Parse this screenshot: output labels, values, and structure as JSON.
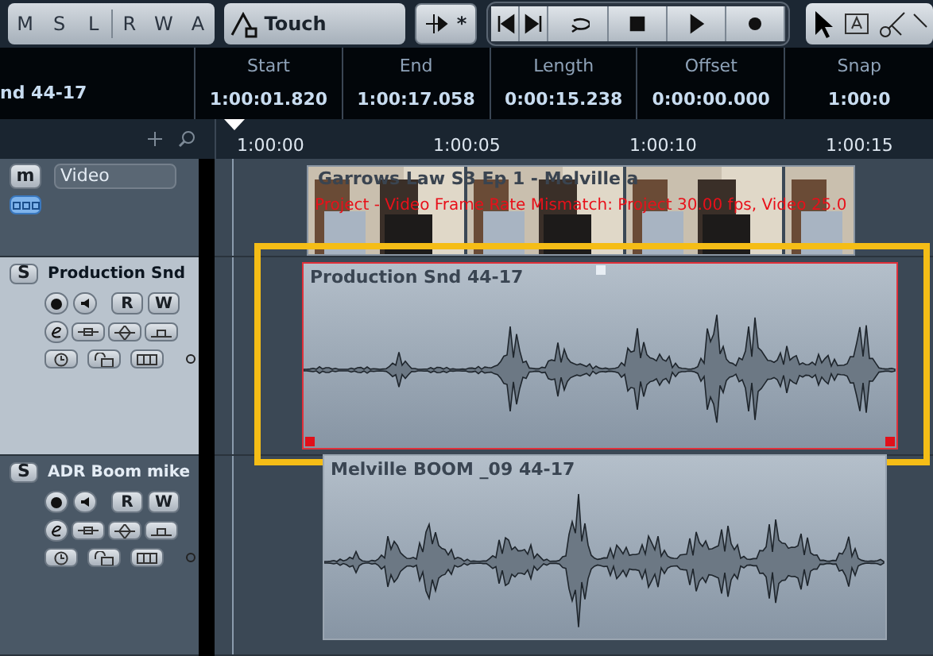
{
  "toolbar": {
    "mode_buttons": [
      "M",
      "S",
      "L",
      "R",
      "W",
      "A"
    ],
    "automation_mode": "Touch",
    "star": "*"
  },
  "info_line": {
    "event_name": "nd 44-17",
    "fields": [
      {
        "label": "Start",
        "value": "1:00:01.820"
      },
      {
        "label": "End",
        "value": "1:00:17.058"
      },
      {
        "label": "Length",
        "value": "0:00:15.238"
      },
      {
        "label": "Offset",
        "value": "0:00:00.000"
      },
      {
        "label": "Snap",
        "value": "1:00:0"
      }
    ]
  },
  "ruler": {
    "labels": [
      "1:00:00",
      "1:00:05",
      "1:00:10",
      "1:00:15"
    ]
  },
  "tracks": [
    {
      "kind": "video",
      "name": "Video",
      "selected": false,
      "button": "m",
      "clip": {
        "title": "Garrows Law S3 Ep 1 - Melville a",
        "warning": "Project - Video Frame Rate Mismatch: Project 30.00 fps, Video 25.0"
      }
    },
    {
      "kind": "audio",
      "name": "Production Snd",
      "selected": true,
      "button": "S",
      "read": "R",
      "write": "W",
      "clip": {
        "title": "Production Snd 44-17",
        "selected": true,
        "highlighted": true
      }
    },
    {
      "kind": "audio",
      "name": "ADR Boom mike",
      "selected": false,
      "button": "S",
      "read": "R",
      "write": "W",
      "clip": {
        "title": "Melville BOOM _09 44-17",
        "selected": false,
        "highlighted": false
      }
    }
  ]
}
